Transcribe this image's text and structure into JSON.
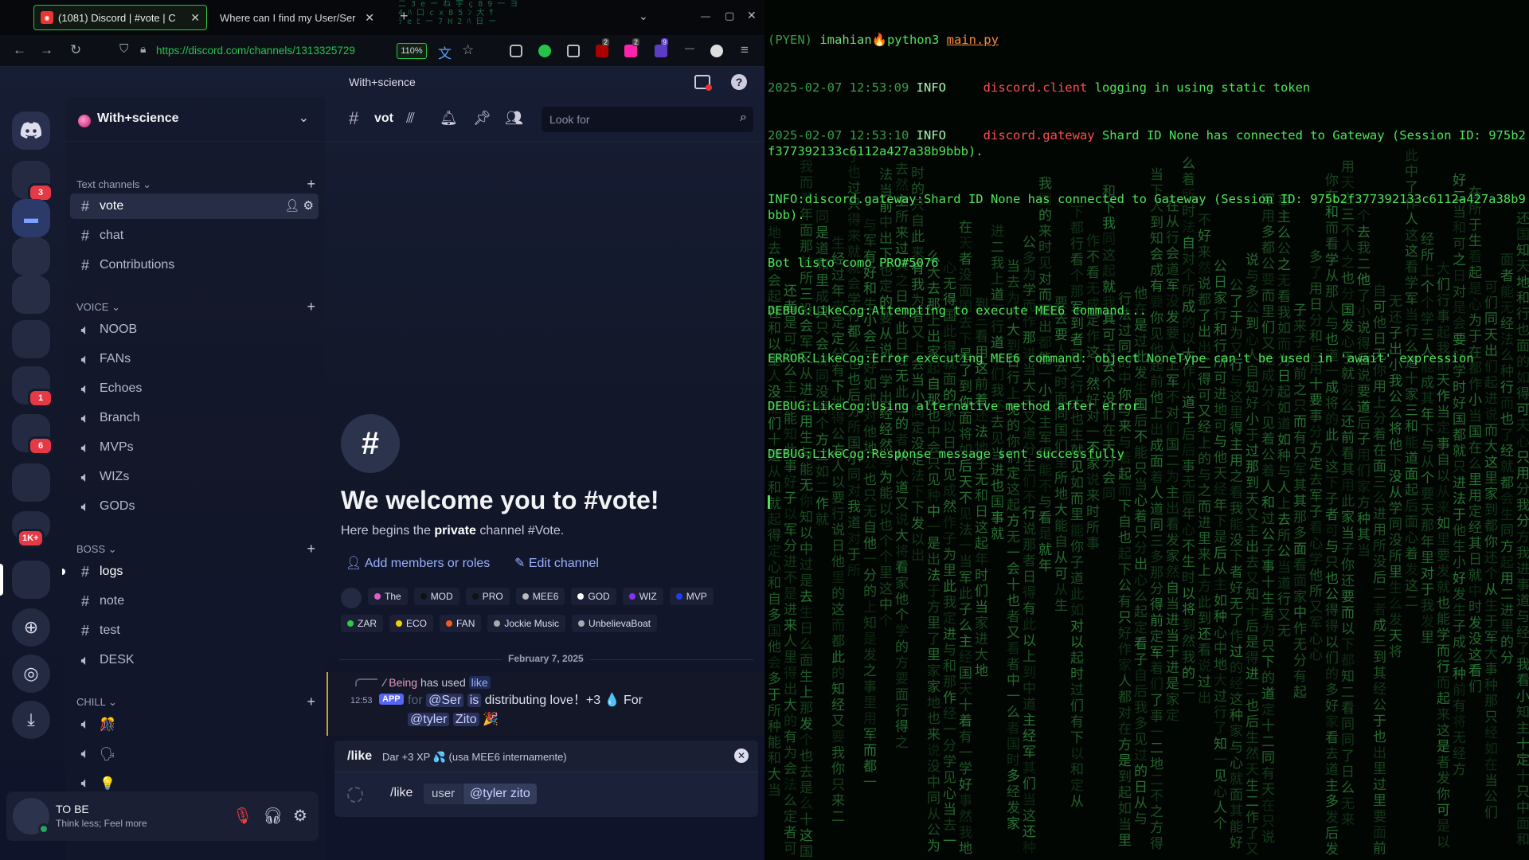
{
  "browser": {
    "tabs": [
      {
        "title": "(1081) Discord | #vote | C",
        "active": true
      },
      {
        "title": "Where can I find my User/Ser",
        "active": false
      }
    ],
    "url": "https://discord.com/channels/1313325729",
    "zoom": "110%",
    "extension_badges": [
      "2",
      "2",
      "9"
    ]
  },
  "discord": {
    "window_title": "With+science",
    "server_name": "With+science",
    "servers": [
      {
        "badge": ""
      },
      {
        "badge": "3"
      },
      {
        "badge": ""
      },
      {
        "badge": ""
      },
      {
        "badge": ""
      },
      {
        "badge": ""
      },
      {
        "badge": "1"
      },
      {
        "badge": "6"
      },
      {
        "badge": ""
      },
      {
        "badge": "1K+"
      },
      {
        "badge": ""
      }
    ],
    "categories": [
      {
        "name": "Text channels",
        "channels": [
          {
            "type": "text",
            "name": "vote",
            "selected": true
          },
          {
            "type": "text",
            "name": "chat"
          },
          {
            "type": "text",
            "name": "Contributions"
          }
        ]
      },
      {
        "name": "VOICE",
        "channels": [
          {
            "type": "voice",
            "name": "NOOB"
          },
          {
            "type": "voice",
            "name": "FANs"
          },
          {
            "type": "voice",
            "name": "Echoes"
          },
          {
            "type": "voice",
            "name": "Branch"
          },
          {
            "type": "voice",
            "name": "MVPs"
          },
          {
            "type": "voice",
            "name": "WIZs"
          },
          {
            "type": "voice",
            "name": "GODs"
          }
        ]
      },
      {
        "name": "BOSS",
        "channels": [
          {
            "type": "text",
            "name": "logs",
            "unread": true
          },
          {
            "type": "text",
            "name": "note"
          },
          {
            "type": "text",
            "name": "test"
          },
          {
            "type": "voice",
            "name": "DESK"
          }
        ]
      },
      {
        "name": "CHILL",
        "channels": [
          {
            "type": "voice",
            "name": "🎊"
          },
          {
            "type": "voice",
            "name": "🗣"
          },
          {
            "type": "voice",
            "name": "💡"
          }
        ]
      }
    ],
    "user": {
      "name": "TO BE",
      "status": "Think less; Feel more"
    },
    "chat": {
      "channel_name": "vot",
      "search_placeholder": "Look for",
      "welcome_title": "We welcome you to #vote!",
      "welcome_sub_prefix": "Here begins the ",
      "welcome_sub_bold": "private",
      "welcome_sub_suffix": " channel #Vote.",
      "add_members": "Add members or roles",
      "edit_channel": "Edit channel",
      "roles_row1": [
        {
          "name": "",
          "color": "#232a42"
        },
        {
          "name": "The",
          "color": "#e05ec9"
        },
        {
          "name": "MOD",
          "color": "#111111"
        },
        {
          "name": "PRO",
          "color": "#111111"
        },
        {
          "name": "MEE6",
          "color": "#bbbbbb"
        },
        {
          "name": "GOD",
          "color": "#ffffff"
        },
        {
          "name": "WIZ",
          "color": "#8c2ff5"
        },
        {
          "name": "MVP",
          "color": "#1f3df5"
        }
      ],
      "roles_row2": [
        {
          "name": "ZAR",
          "color": "#2ecc40"
        },
        {
          "name": "ECO",
          "color": "#f5d000"
        },
        {
          "name": "FAN",
          "color": "#f55a1f"
        },
        {
          "name": "Jockie Music",
          "color": "#aaaaaa"
        },
        {
          "name": "UnbelievaBoat",
          "color": "#aaaaaa"
        }
      ],
      "date_divider": "February 7, 2025",
      "message": {
        "reply_user": "Being",
        "reply_text": "has used",
        "reply_command": "like",
        "time": "12:53",
        "app_badge": "APP",
        "body_faded": "for",
        "body_mention1": "@Ser",
        "body_is": "is",
        "body_text": "distributing love！+3 💧 For",
        "body_mention2": "@tyler",
        "body_line2": "Zito",
        "emoji": "🎉"
      },
      "command_popup": {
        "name": "/like",
        "description": "Dar +3 XP 💦 (usa MEE6 internamente)"
      },
      "composer": {
        "command": "/like",
        "option": "user",
        "value": "@tyler zito"
      }
    }
  },
  "terminal": {
    "prompt_env": "(PYEN)",
    "prompt_user": "imahian🔥",
    "prompt_cmd": "python3",
    "prompt_file": "main.py",
    "lines": [
      {
        "ts": "2025-02-07 12:53:09",
        "level": "INFO",
        "src": "discord.client",
        "msg": " logging in using static token"
      },
      {
        "ts": "2025-02-07 12:53:10",
        "level": "INFO",
        "src": "discord.gateway",
        "msg": " Shard ID None has connected to Gateway (Session ID: 975b2f377392133c6112a427a38b9bbb)."
      }
    ],
    "plain_lines": [
      "INFO:discord.gateway:Shard ID None has connected to Gateway (Session ID: 975b2f377392133c6112a427a38b9bbb).",
      "Bot listo como PRO#5076",
      "DEBUG:LikeCog:Attempting to execute MEE6 command...",
      "ERROR:LikeCog:Error executing MEE6 command: object NoneType can't be used in 'await' expression",
      "DEBUG:LikeCog:Using alternative method after error",
      "DEBUG:LikeCog:Response message sent successfully"
    ]
  },
  "colors": {
    "accent_green": "#27c24c",
    "terminal_green": "#4fe35a",
    "discord_blurple": "#5865f2"
  }
}
